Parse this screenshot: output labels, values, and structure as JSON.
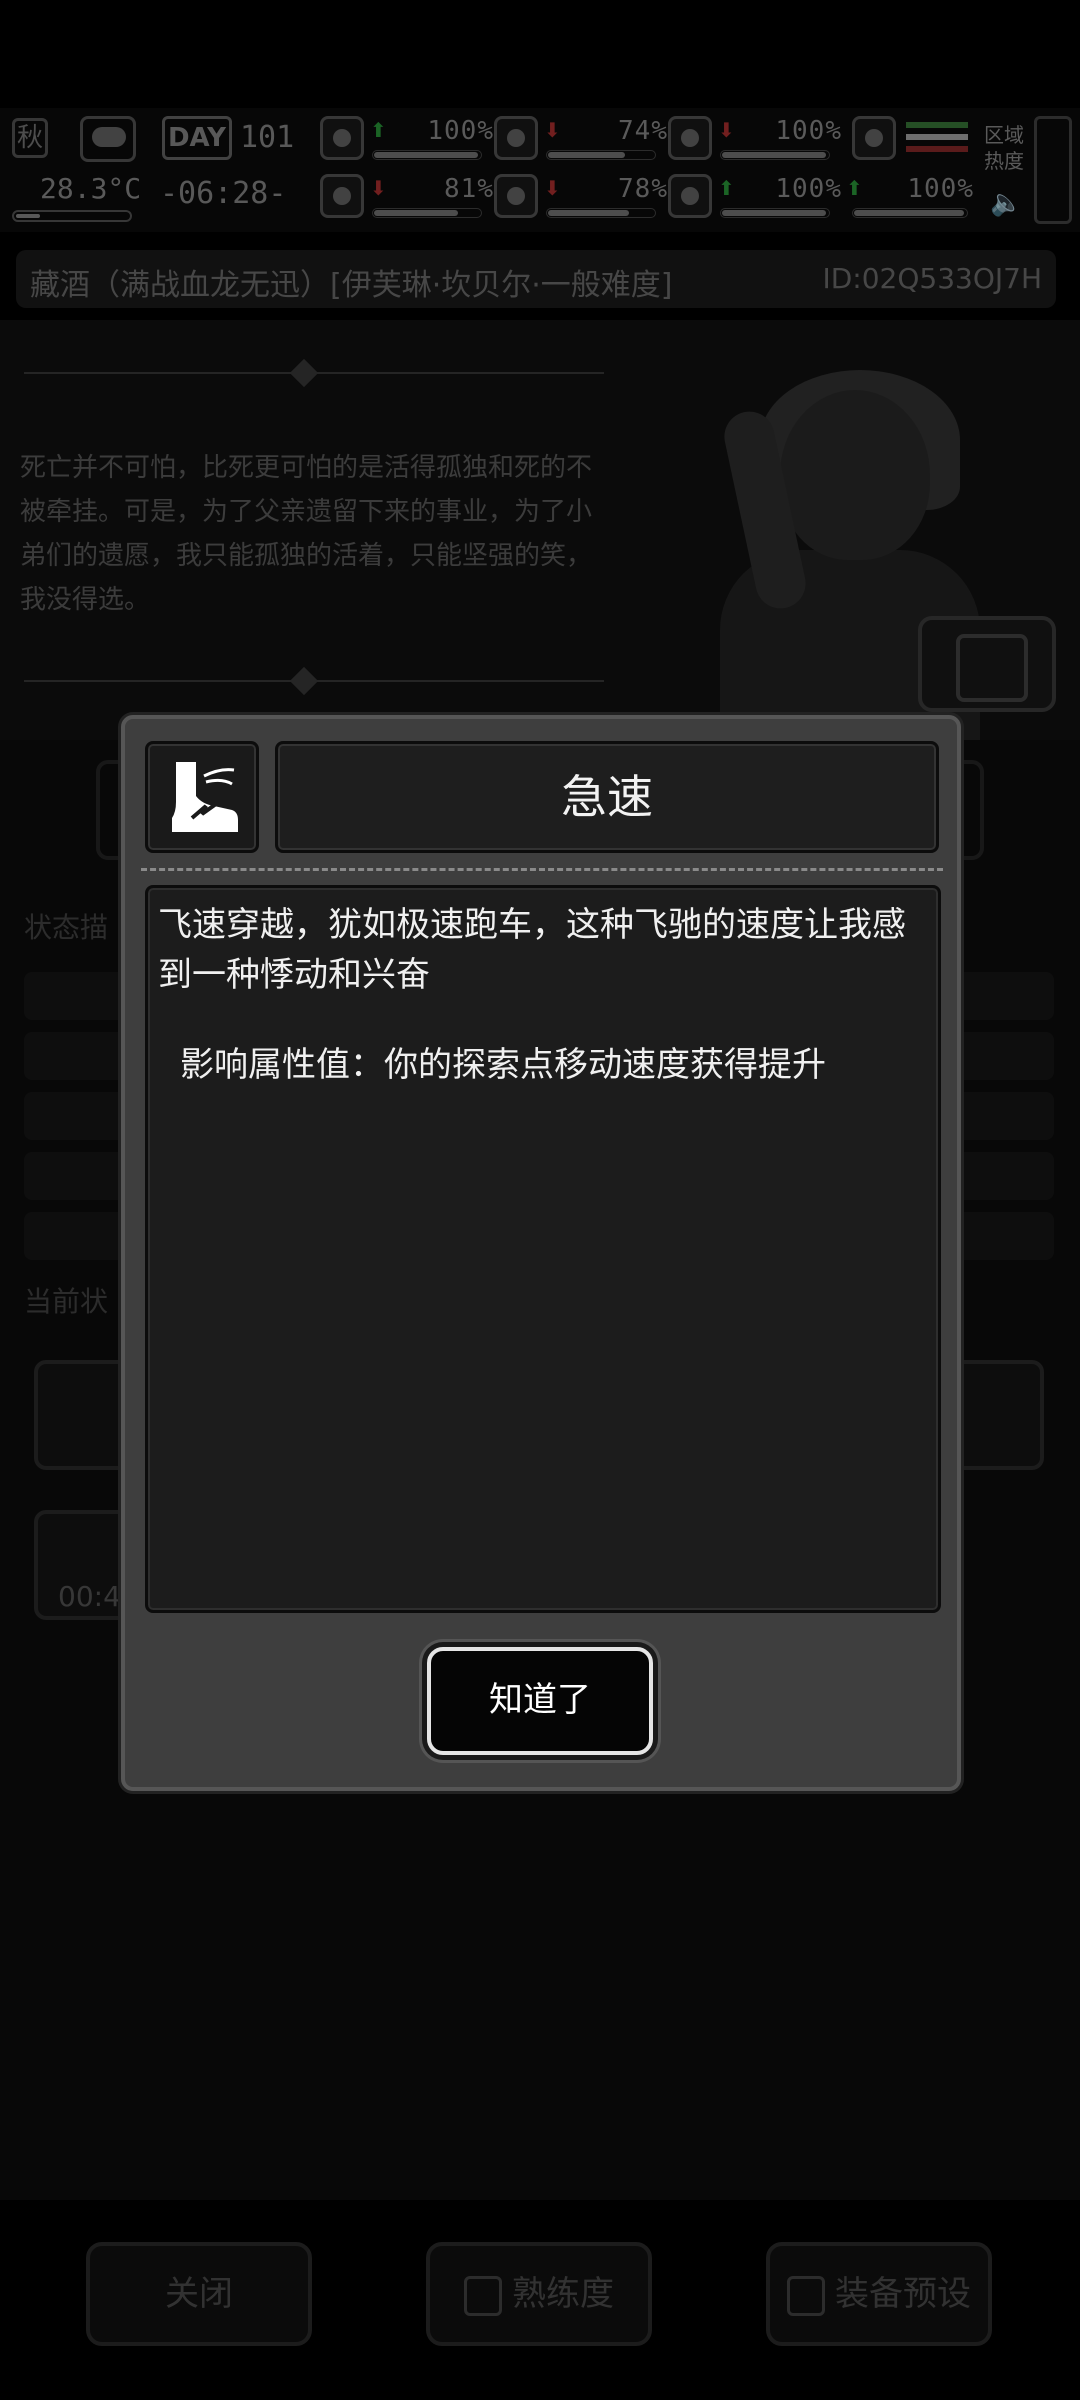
{
  "hud": {
    "season": "秋",
    "temperature": "28.3°C",
    "day_label": "DAY",
    "day_number": "101",
    "clock": "-06:28-",
    "stats": [
      {
        "icon": "medkit-icon",
        "trend": "up",
        "value": "100%",
        "level": 1.0
      },
      {
        "icon": "stomach-icon",
        "trend": "down",
        "value": "74%",
        "level": 0.74
      },
      {
        "icon": "bladder-icon",
        "trend": "down",
        "value": "100%",
        "level": 1.0
      },
      {
        "icon": "brain-icon",
        "trend": "down",
        "value": "81%",
        "level": 0.81
      },
      {
        "icon": "water-drop-icon",
        "trend": "down",
        "value": "78%",
        "level": 0.78
      },
      {
        "icon": "heart-icon",
        "trend": "up",
        "value": "100%",
        "level": 1.0
      },
      {
        "icon": "flask-icon",
        "trend": "up",
        "value": "100%",
        "level": 1.0
      }
    ],
    "region_heat_label": "区域热度"
  },
  "title_bar": {
    "title": "藏酒（满战血龙无迅）[伊芙琳·坎贝尔·一般难度]",
    "id": "ID:02Q533OJ7H"
  },
  "story": {
    "quote": "死亡并不可怕，比死更可怕的是活得孤独和死的不被牵挂。可是，为了父亲遗留下来的事业，为了小弟们的遗愿，我只能孤独的活着，只能坚强的笑，我没得选。"
  },
  "under": {
    "status_desc_label": "状态描",
    "current_status_label": "当前状",
    "timer": "00:4"
  },
  "bottom": {
    "close_label": "关闭",
    "proficiency_label": "熟练度",
    "equip_preset_label": "装备预设"
  },
  "modal": {
    "skill_icon": "winged-boot-icon",
    "title": "急速",
    "description": "飞速穿越，犹如极速跑车，这种飞驰的速度让我感到一种悸动和兴奋",
    "effect": "影响属性值：你的探索点移动速度获得提升",
    "confirm_label": "知道了"
  },
  "colors": {
    "trend_up": "#2a9a3a",
    "trend_down": "#b03030",
    "modal_bg": "#3e3e3e",
    "panel_bg": "#1c1c1c"
  }
}
